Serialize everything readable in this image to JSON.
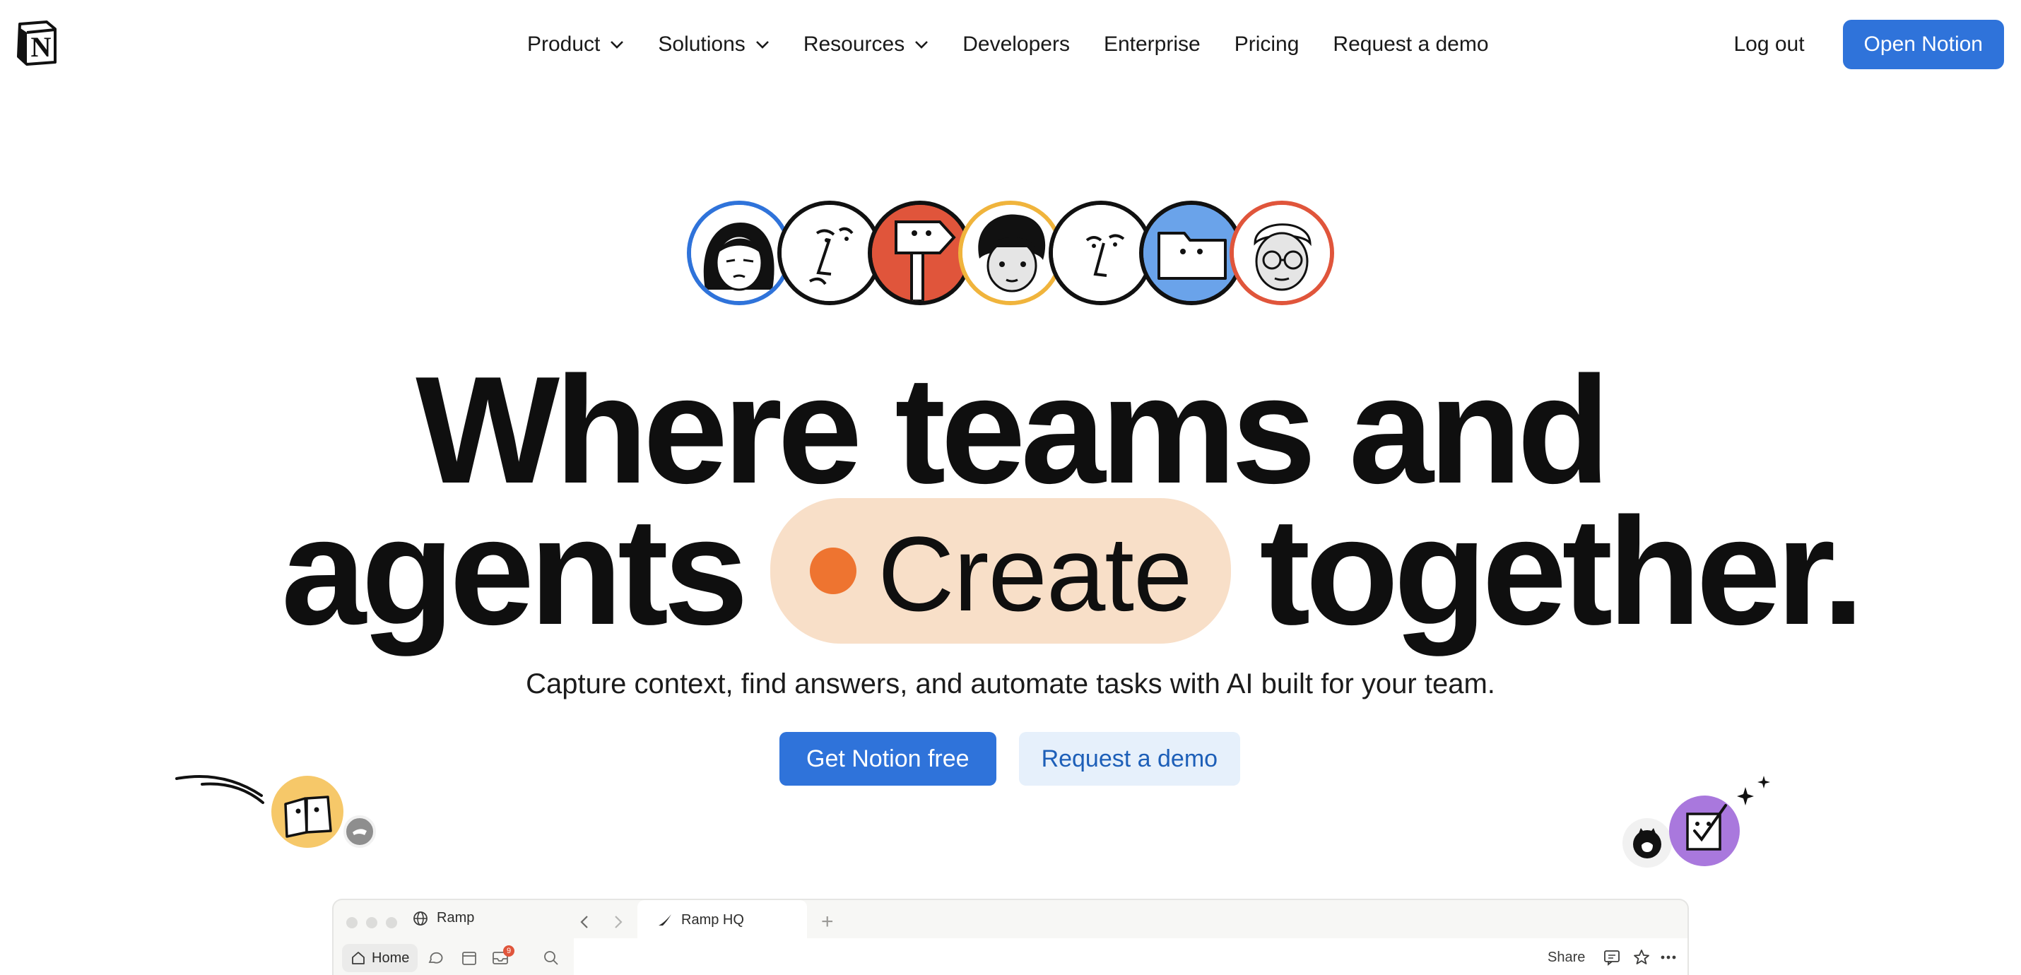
{
  "nav": {
    "logo_letter": "N",
    "items": [
      {
        "label": "Product",
        "dropdown": true
      },
      {
        "label": "Solutions",
        "dropdown": true
      },
      {
        "label": "Resources",
        "dropdown": true
      },
      {
        "label": "Developers",
        "dropdown": false
      },
      {
        "label": "Enterprise",
        "dropdown": false
      },
      {
        "label": "Pricing",
        "dropdown": false
      },
      {
        "label": "Request a demo",
        "dropdown": false
      }
    ],
    "logout": "Log out",
    "open_notion": "Open Notion"
  },
  "hero": {
    "line1": "Where teams and",
    "line2_before": "agents",
    "pill_word": "Create",
    "line2_after": "together.",
    "subtitle": "Capture context, find answers, and automate tasks with AI built for your team.",
    "primary_cta": "Get Notion free",
    "secondary_cta": "Request a demo"
  },
  "avatars": [
    {
      "icon": "woman-face-icon",
      "ring": "#2f73da"
    },
    {
      "icon": "line-face-icon",
      "ring": "#111111"
    },
    {
      "icon": "signpost-icon",
      "ring": "#111111"
    },
    {
      "icon": "curly-hair-face-icon",
      "ring": "#f0b43c"
    },
    {
      "icon": "line-face-icon",
      "ring": "#111111"
    },
    {
      "icon": "folder-icon",
      "ring": "#111111"
    },
    {
      "icon": "glasses-face-icon",
      "ring": "#e0553b"
    }
  ],
  "app_window": {
    "workspace": "Ramp",
    "tab": "Ramp HQ",
    "home": "Home",
    "notification_count": "9",
    "share": "Share"
  },
  "colors": {
    "accent": "#2f73da",
    "pill_bg": "#f8dfc8",
    "pill_dot": "#ee7430",
    "secondary_bg": "#e6f0fb"
  }
}
